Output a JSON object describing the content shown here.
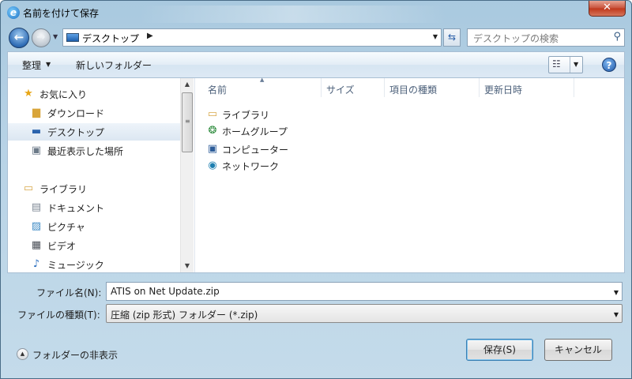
{
  "window": {
    "title": "名前を付けて保存",
    "close_label": "✕"
  },
  "nav": {
    "address": "デスクトップ",
    "search_placeholder": "デスクトップの検索"
  },
  "toolbar": {
    "organize": "整理",
    "new_folder": "新しいフォルダー",
    "help": "?"
  },
  "sidebar": {
    "items": [
      {
        "label": "お気に入り",
        "icon": "star-icon"
      },
      {
        "label": "ダウンロード",
        "icon": "download-folder-icon"
      },
      {
        "label": "デスクトップ",
        "icon": "desktop-icon",
        "selected": true
      },
      {
        "label": "最近表示した場所",
        "icon": "recent-places-icon"
      },
      {
        "label": "ライブラリ",
        "icon": "library-icon"
      },
      {
        "label": "ドキュメント",
        "icon": "document-icon"
      },
      {
        "label": "ピクチャ",
        "icon": "picture-icon"
      },
      {
        "label": "ビデオ",
        "icon": "video-icon"
      },
      {
        "label": "ミュージック",
        "icon": "music-icon"
      }
    ]
  },
  "file_list": {
    "columns": [
      "名前",
      "サイズ",
      "項目の種類",
      "更新日時"
    ],
    "items": [
      {
        "label": "ライブラリ",
        "icon": "library-icon"
      },
      {
        "label": "ホームグループ",
        "icon": "homegroup-icon"
      },
      {
        "label": "コンピューター",
        "icon": "computer-icon"
      },
      {
        "label": "ネットワーク",
        "icon": "network-icon"
      }
    ]
  },
  "form": {
    "filename_label": "ファイル名(N):",
    "filename_value": "ATIS on Net Update.zip",
    "filetype_label": "ファイルの種類(T):",
    "filetype_value": "圧縮 (zip 形式) フォルダー (*.zip)",
    "hide_folders": "フォルダーの非表示",
    "save": "保存(S)",
    "cancel": "キャンセル"
  }
}
